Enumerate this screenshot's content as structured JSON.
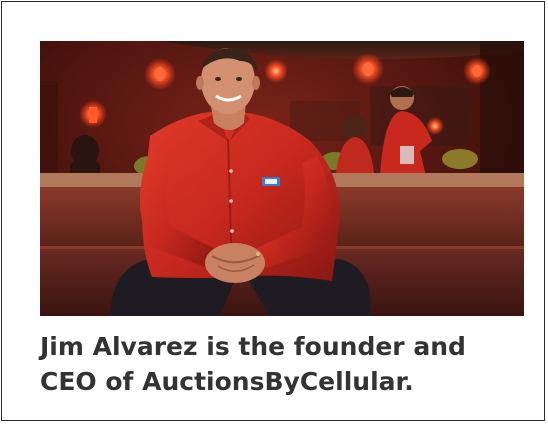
{
  "caption": "Jim Alvarez is the founder and CEO of AuctionsByCellular.",
  "photo": {
    "subject": "man-in-red-shirt",
    "setting": "restaurant-bar"
  },
  "colors": {
    "border": "#2b2b2b",
    "caption_text": "#333333",
    "shirt_red": "#c8281e",
    "background_red": "#6e1a14",
    "lamp_glow": "#ff4a2a"
  }
}
